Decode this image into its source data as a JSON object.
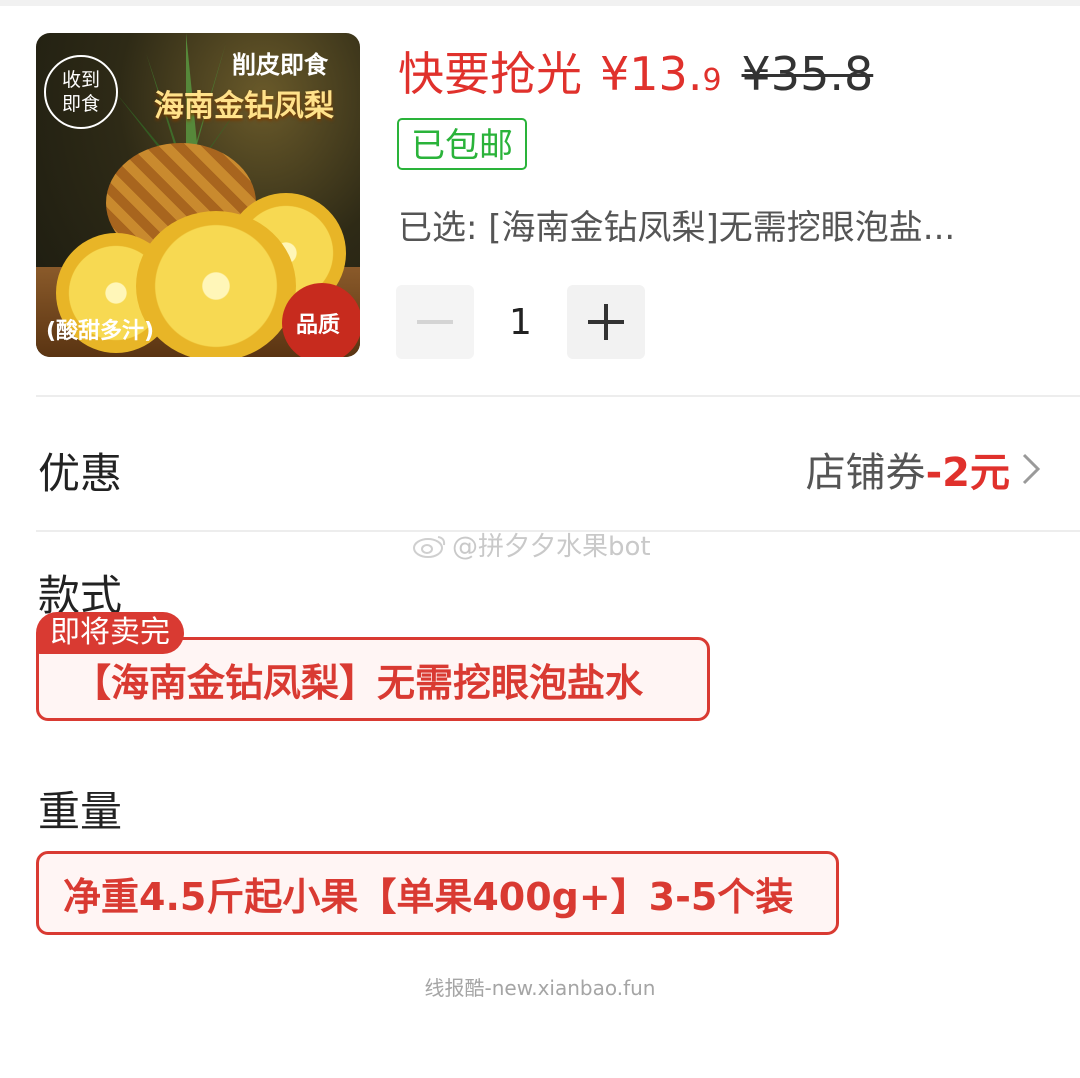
{
  "product": {
    "image": {
      "badge_circle": "收到\n即食",
      "headline_small": "削皮即食",
      "headline_big": "海南金钻凤梨",
      "tagline": "(酸甜多汁)",
      "quality_badge": "品质"
    },
    "price": {
      "hurry_label": "快要抢光",
      "currency": "¥",
      "integer": "13.",
      "decimal": "9",
      "original": "¥35.8"
    },
    "shipping_badge": "已包邮",
    "selected_text": "已选: [海南金钻凤梨]无需挖眼泡盐...",
    "quantity": "1"
  },
  "coupon": {
    "label": "优惠",
    "text": "店铺券",
    "amount": "-2元"
  },
  "watermark": "@拼夕夕水果bot",
  "style_section": {
    "label": "款式",
    "sellout_badge": "即将卖完",
    "option": "【海南金钻凤梨】无需挖眼泡盐水"
  },
  "weight_section": {
    "label": "重量",
    "option": "净重4.5斤起小果【单果400g+】3-5个装"
  },
  "footer_text": "线报酷-new.xianbao.fun",
  "colors": {
    "accent_red": "#e0312c",
    "shipping_green": "#2ab33a"
  }
}
